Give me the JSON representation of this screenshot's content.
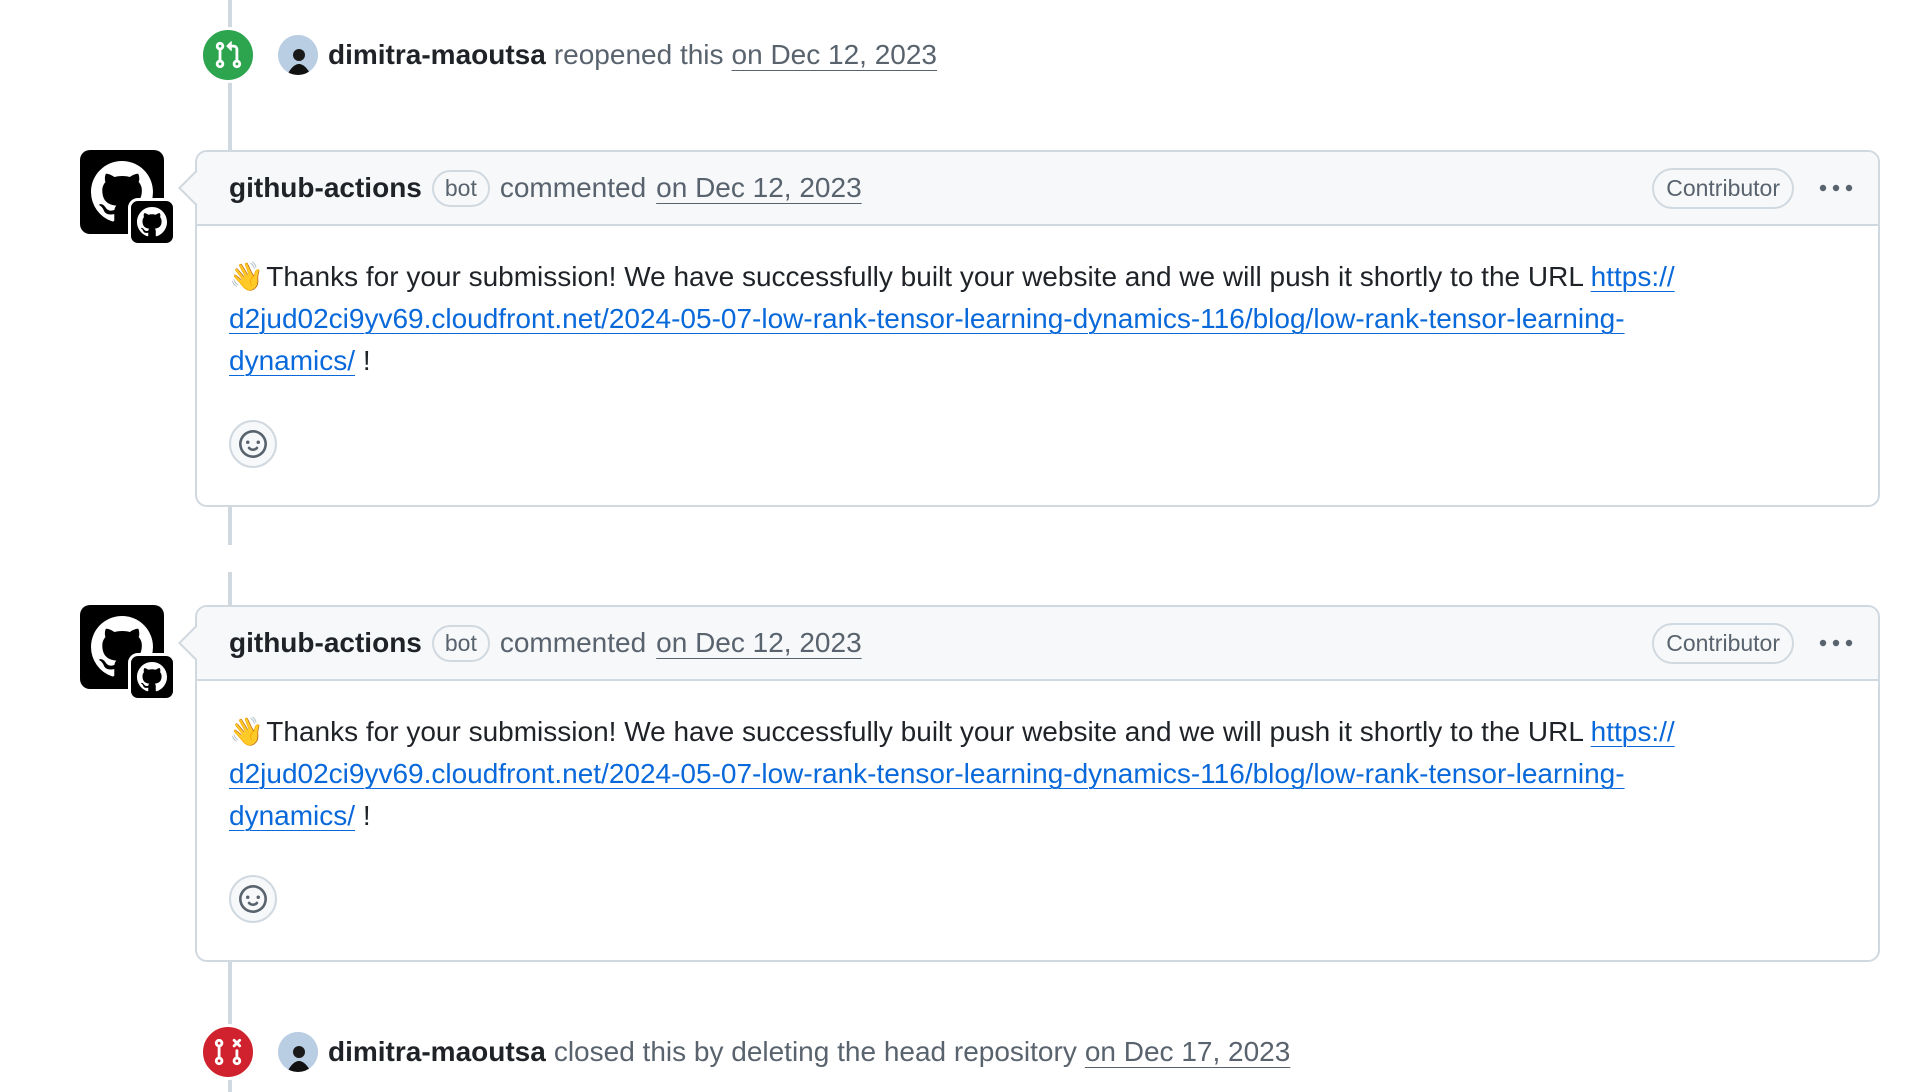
{
  "events": [
    {
      "actor": "dimitra-maoutsa",
      "action": "reopened this",
      "date": "on Dec 12, 2023",
      "icon": "git-pull-request-icon",
      "badge_color": "#2da44e"
    },
    {
      "actor": "dimitra-maoutsa",
      "action": "closed this by deleting the head repository",
      "date": "on Dec 17, 2023",
      "icon": "git-pull-request-closed-icon",
      "badge_color": "#cf222e"
    }
  ],
  "comments": [
    {
      "author": "github-actions",
      "bot_label": "bot",
      "action": "commented",
      "date": "on Dec 12, 2023",
      "role": "Contributor",
      "emoji": "👋",
      "text": "Thanks for your submission! We have successfully built your website and we will push it shortly to the URL",
      "link_line1": "https://",
      "link_line2": "d2jud02ci9yv69.cloudfront.net/2024-05-07-low-rank-tensor-learning-dynamics-116/blog/low-rank-tensor-learning-",
      "link_line3": "dynamics/",
      "trailing": "!"
    },
    {
      "author": "github-actions",
      "bot_label": "bot",
      "action": "commented",
      "date": "on Dec 12, 2023",
      "role": "Contributor",
      "emoji": "👋",
      "text": "Thanks for your submission! We have successfully built your website and we will push it shortly to the URL",
      "link_line1": "https://",
      "link_line2": "d2jud02ci9yv69.cloudfront.net/2024-05-07-low-rank-tensor-learning-dynamics-116/blog/low-rank-tensor-learning-",
      "link_line3": "dynamics/",
      "trailing": "!"
    }
  ],
  "colors": {
    "link": "#0969da",
    "muted": "#59636e",
    "border": "#d1d9e0"
  }
}
